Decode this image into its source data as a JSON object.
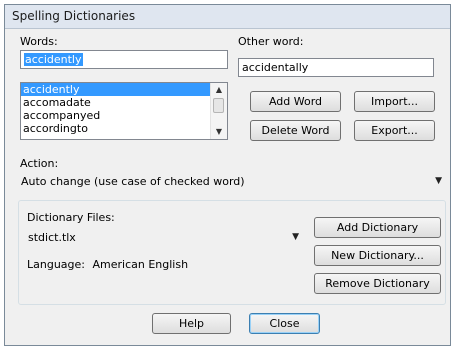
{
  "window": {
    "title": "Spelling Dictionaries"
  },
  "words": {
    "label": "Words:",
    "current_value": "accidently",
    "list": [
      "accidently",
      "accomadate",
      "accompanyed",
      "accordingto"
    ],
    "selected": "accidently"
  },
  "other_word": {
    "label": "Other word:",
    "value": "accidentally"
  },
  "buttons": {
    "add_word": "Add Word",
    "import": "Import...",
    "delete_word": "Delete Word",
    "export": "Export...",
    "add_dictionary": "Add Dictionary",
    "new_dictionary": "New Dictionary...",
    "remove_dictionary": "Remove Dictionary",
    "help": "Help",
    "close": "Close"
  },
  "action": {
    "label": "Action:",
    "value": "Auto change (use case of checked word)"
  },
  "dictionary": {
    "label": "Dictionary Files:",
    "file": "stdict.tlx",
    "language_label": "Language:",
    "language": "American English"
  },
  "icons": {
    "scroll_up": "scroll-up-arrow",
    "scroll_down": "scroll-down-arrow",
    "dropdown": "chevron-down"
  },
  "colors": {
    "selection": "#3399ff",
    "dialog_bg": "#f0f0f0",
    "titlebar_bg": "#dfe6f0"
  }
}
